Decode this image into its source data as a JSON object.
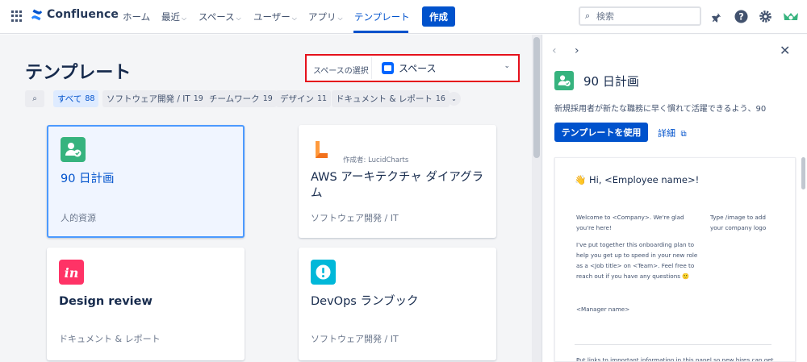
{
  "nav": {
    "product": "Confluence",
    "items": [
      {
        "label": "ホーム",
        "chevron": false
      },
      {
        "label": "最近",
        "chevron": true
      },
      {
        "label": "スペース",
        "chevron": true
      },
      {
        "label": "ユーザー",
        "chevron": true
      },
      {
        "label": "アプリ",
        "chevron": true
      },
      {
        "label": "テンプレート",
        "chevron": false,
        "active": true
      }
    ],
    "create_label": "作成",
    "search_placeholder": "検索",
    "right_icons": [
      "notification-bell-icon",
      "help-icon",
      "settings-gear-icon",
      "user-avatar-icon"
    ]
  },
  "main": {
    "title": "テンプレート",
    "space_select": {
      "label": "スペースの選択",
      "value": "スペース"
    },
    "filters": [
      {
        "label": "すべて",
        "count": "88",
        "active": true
      },
      {
        "label": "ソフトウェア開発 / IT",
        "count": "19"
      },
      {
        "label": "チームワーク",
        "count": "19"
      },
      {
        "label": "デザイン",
        "count": "11"
      },
      {
        "label": "ドキュメント & レポート",
        "count": "16"
      }
    ],
    "cards": [
      {
        "title": "90 日計画",
        "category": "人的資源",
        "icon": "people-check-icon",
        "selected": true
      },
      {
        "title": "AWS アーキテクチャ ダイアグラム",
        "category": "ソフトウェア開発 / IT",
        "author": "作成者: LucidCharts",
        "icon": "lucidcharts-logo-icon"
      },
      {
        "title": "Design review",
        "category": "ドキュメント & レポート",
        "icon": "invision-logo-icon"
      },
      {
        "title": "DevOps ランブック",
        "category": "ソフトウェア開発 / IT",
        "icon": "alert-icon"
      }
    ]
  },
  "preview_panel": {
    "title": "90 日計画",
    "description": "新規採用者が新たな職務に早く慣れて活躍できるよう、90",
    "use_label": "テンプレートを使用",
    "details_label": "詳細",
    "greeting": "👋 Hi, <Employee name>!",
    "welcome": "Welcome to <Company>. We're glad\nyou're here!",
    "image_hint": "Type /image to add\nyour company logo",
    "plan_text": "I've put together this onboarding plan to\nhelp you get up to speed in your new role\nas a <Job title> on <Team>. Feel free to\nreach out if you have any questions 🙂",
    "manager": "<Manager name>",
    "links_text": "Put links to important information in this panel so new hires can get"
  },
  "colors": {
    "brand": "#0052cc",
    "selection_highlight": "#e5111c",
    "template_green": "#36b37e",
    "invision_pink": "#ff3366",
    "devops_teal": "#00b8d9",
    "lucid_orange": "#f2711c"
  }
}
